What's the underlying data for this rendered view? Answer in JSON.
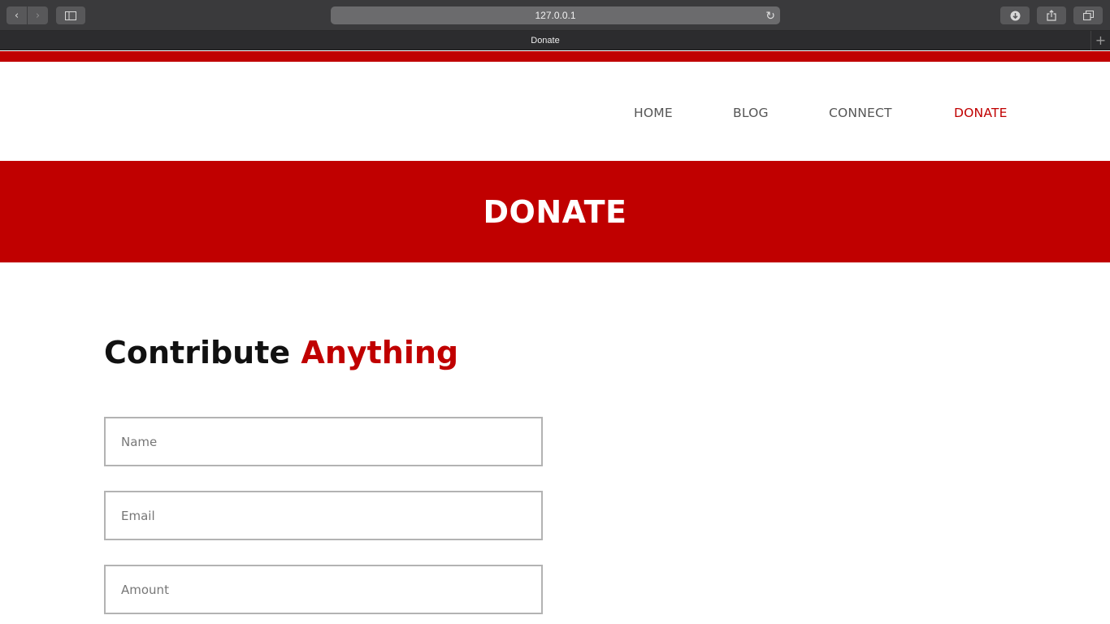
{
  "browser": {
    "url": "127.0.0.1",
    "tab_title": "Donate",
    "icons": {
      "back": "chevron-left-icon",
      "forward": "chevron-right-icon",
      "sidebar": "sidebar-icon",
      "reload": "reload-icon",
      "download": "download-icon",
      "share": "share-icon",
      "tabs": "tabs-icon",
      "new_tab": "plus-icon"
    }
  },
  "nav": {
    "items": [
      {
        "label": "HOME"
      },
      {
        "label": "BLOG"
      },
      {
        "label": "CONNECT"
      },
      {
        "label": "DONATE",
        "active": true
      }
    ]
  },
  "banner": {
    "title": "DONATE"
  },
  "form": {
    "heading_plain": "Contribute",
    "heading_accent": "Anything",
    "fields": {
      "name": {
        "placeholder": "Name",
        "value": ""
      },
      "email": {
        "placeholder": "Email",
        "value": ""
      },
      "amount": {
        "placeholder": "Amount",
        "value": ""
      }
    }
  },
  "colors": {
    "accent": "#c00000",
    "nav_text": "#555555",
    "heading_text": "#111111",
    "field_border": "#b3b3b3"
  }
}
